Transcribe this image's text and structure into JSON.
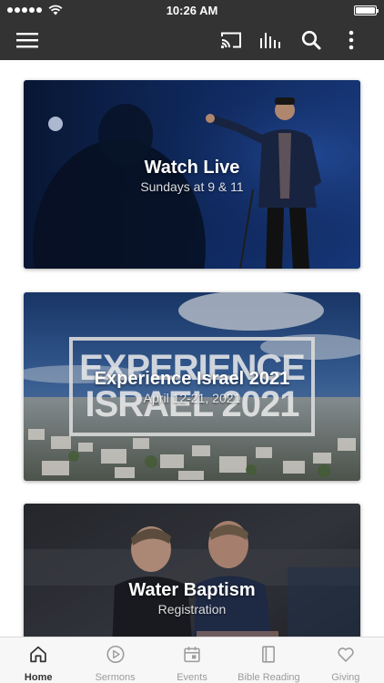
{
  "status_bar": {
    "time": "10:26 AM",
    "battery_level": 1.0
  },
  "toolbar": {
    "icons": [
      "hamburger-menu-icon",
      "cast-icon",
      "audio-bars-icon",
      "search-icon",
      "more-vertical-icon"
    ]
  },
  "feed": {
    "cards": [
      {
        "title": "Watch Live",
        "subtitle": "Sundays at 9 & 11"
      },
      {
        "title": "Experience Israel 2021",
        "subtitle": "April 12-21, 2021",
        "banner_line1": "EXPERIENCE",
        "banner_line2": "ISRAEL 2021"
      },
      {
        "title": "Water Baptism",
        "subtitle": "Registration"
      }
    ]
  },
  "tabbar": {
    "tabs": [
      {
        "label": "Home",
        "icon": "home-icon",
        "active": true
      },
      {
        "label": "Sermons",
        "icon": "play-circle-icon",
        "active": false
      },
      {
        "label": "Events",
        "icon": "calendar-icon",
        "active": false
      },
      {
        "label": "Bible Reading",
        "icon": "book-icon",
        "active": false
      },
      {
        "label": "Giving",
        "icon": "heart-icon",
        "active": false
      }
    ]
  },
  "colors": {
    "bar": "#333333",
    "tab_active": "#333333",
    "tab_inactive": "#9b9b9b"
  }
}
